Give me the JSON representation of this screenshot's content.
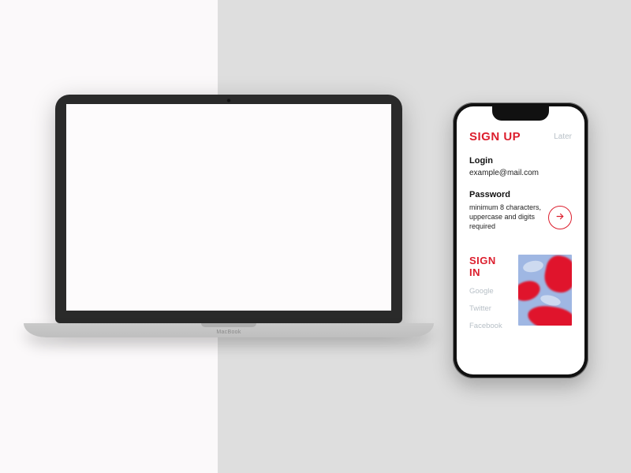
{
  "laptop": {
    "brand": "MacBook"
  },
  "phone": {
    "header": {
      "title": "SIGN UP",
      "skip": "Later"
    },
    "login": {
      "label": "Login",
      "placeholder": "example@mail.com"
    },
    "password": {
      "label": "Password",
      "hint": "minimum 8 characters, uppercase and digits required"
    },
    "signin": {
      "title": "SIGN IN",
      "providers": [
        "Google",
        "Twitter",
        "Facebook"
      ]
    }
  },
  "colors": {
    "accent": "#dc1e2d",
    "muted": "#b8c0c7"
  }
}
